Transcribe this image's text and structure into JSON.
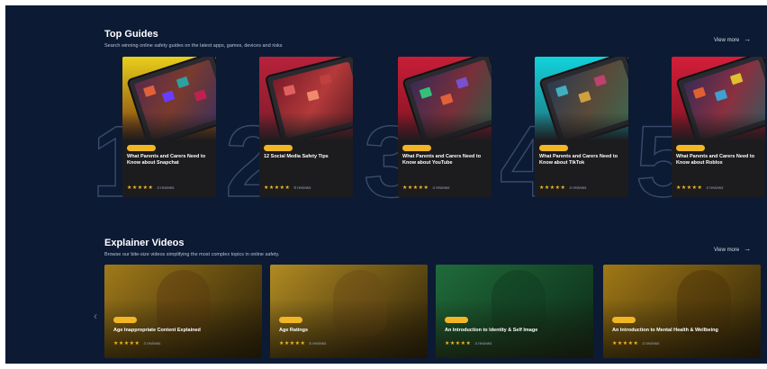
{
  "top_guides": {
    "title": "Top Guides",
    "subtitle": "Search winning online safety guides on the latest apps, games, devices and risks",
    "view_more": "View more",
    "arrow_icon": "arrow-right-icon",
    "cards": [
      {
        "rank": "1",
        "title": "What Parents and Carers Need to Know about Snapchat",
        "stars": "★★★★★",
        "reviews": "4 reviews",
        "color_top": "#e8cf1c",
        "color_bottom": "#7a3b0e"
      },
      {
        "rank": "2",
        "title": "12 Social Media Safety Tips",
        "stars": "★★★★★",
        "reviews": "9 reviews",
        "color_top": "#b8213b",
        "color_bottom": "#7a1d2a"
      },
      {
        "rank": "3",
        "title": "What Parents and Carers Need to Know about YouTube",
        "stars": "★★★★★",
        "reviews": "4 reviews",
        "color_top": "#c81e38",
        "color_bottom": "#7c1322"
      },
      {
        "rank": "4",
        "title": "What Parents and Carers Need to Know about TikTok",
        "stars": "★★★★★",
        "reviews": "4 reviews",
        "color_top": "#12d2dc",
        "color_bottom": "#1f6f78"
      },
      {
        "rank": "5",
        "title": "What Parents and Carers Need to Know about Roblox",
        "stars": "★★★★★",
        "reviews": "4 reviews",
        "color_top": "#d41e3a",
        "color_bottom": "#7a1322"
      }
    ]
  },
  "explainer_videos": {
    "title": "Explainer Videos",
    "subtitle": "Browse our bite-size videos simplifying the most complex topics in online safety.",
    "view_more": "View more",
    "arrow_icon": "arrow-right-icon",
    "nav_left_icon": "chevron-left-icon",
    "videos": [
      {
        "title": "Age Inappropriate Content Explained",
        "stars": "★★★★★",
        "reviews": "4 reviews",
        "color": "#a07a1a"
      },
      {
        "title": "Age Ratings",
        "stars": "★★★★★",
        "reviews": "5 reviews",
        "color": "#b08a22"
      },
      {
        "title": "An Introduction to Identity & Self Image",
        "stars": "★★★★★",
        "reviews": "4 reviews",
        "color": "#1f6b3a"
      },
      {
        "title": "An Introduction to Mental Health & Wellbeing",
        "stars": "★★★★★",
        "reviews": "4 reviews",
        "color": "#a07816"
      }
    ]
  }
}
